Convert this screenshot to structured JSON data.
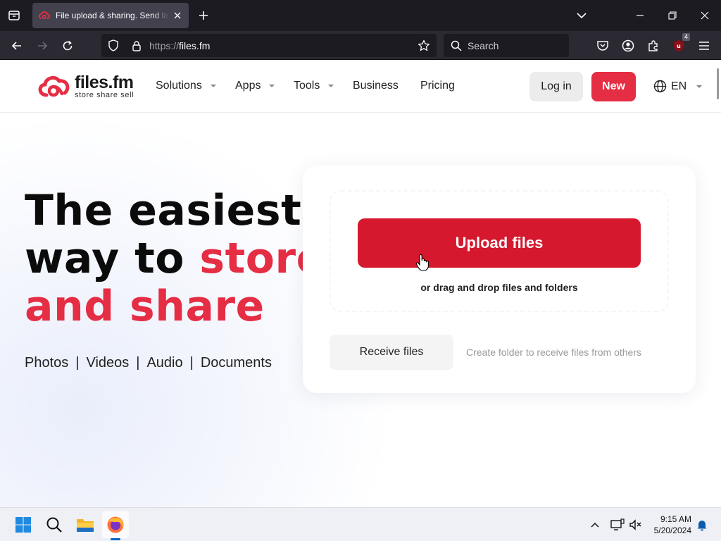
{
  "browser": {
    "tab": {
      "title": "File upload & sharing. Send large files"
    },
    "url": {
      "scheme": "https://",
      "host": "files.fm"
    },
    "search": {
      "placeholder": "Search"
    },
    "extension_badge": "4"
  },
  "site": {
    "logo": {
      "name": "files.fm",
      "tagline": "store  share  sell"
    },
    "menu": [
      {
        "label": "Solutions",
        "has_dropdown": true
      },
      {
        "label": "Apps",
        "has_dropdown": true
      },
      {
        "label": "Tools",
        "has_dropdown": true
      },
      {
        "label": "Business",
        "has_dropdown": false
      },
      {
        "label": "Pricing",
        "has_dropdown": false
      }
    ],
    "login_label": "Log in",
    "new_label": "New",
    "language": "EN",
    "hero": {
      "line1": "The easiest",
      "line2_plain": "way to ",
      "line2_accent": "store",
      "line3_accent": "and share",
      "types": [
        "Photos",
        "Videos",
        "Audio",
        "Documents"
      ],
      "separator": "|"
    },
    "upload": {
      "button_label": "Upload files",
      "drag_text": "or drag and drop files and folders",
      "receive_label": "Receive files",
      "receive_description": "Create folder to receive files from others"
    },
    "colors": {
      "brand_red": "#e52d44",
      "upload_red": "#d5182e"
    }
  },
  "taskbar": {
    "time": "9:15 AM",
    "date": "5/20/2024",
    "apps": [
      "start-icon",
      "search-icon",
      "file-explorer-icon",
      "firefox-icon"
    ]
  }
}
